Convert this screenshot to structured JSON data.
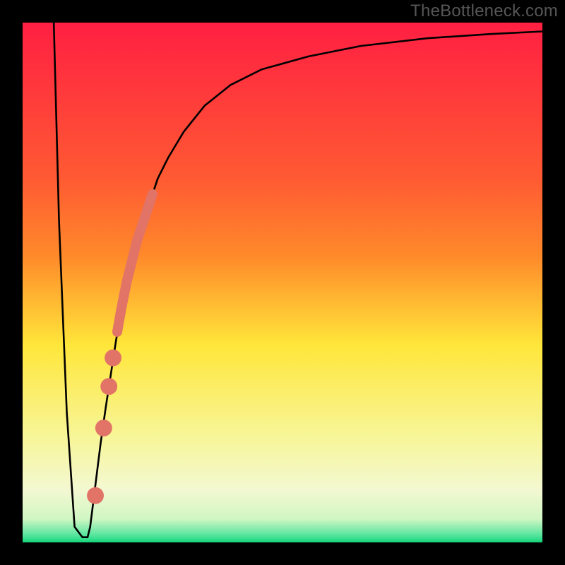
{
  "watermark": "TheBottleneck.com",
  "colors": {
    "frame": "#000000",
    "curve": "#000000",
    "marker": "#e27367",
    "gradient_top": "#ff1f42",
    "gradient_mid_upper": "#ff8a2a",
    "gradient_mid": "#ffe63a",
    "gradient_mid_lower": "#f7f69a",
    "gradient_low": "#d0f6c3",
    "gradient_bottom": "#14d47a"
  },
  "chart_data": {
    "type": "line",
    "title": "",
    "xlabel": "",
    "ylabel": "",
    "xlim": [
      0,
      100
    ],
    "ylim": [
      0,
      100
    ],
    "curve": {
      "x": [
        6,
        7,
        8.5,
        10,
        11.5,
        12.5,
        13,
        14,
        15,
        16,
        18,
        20,
        22,
        24,
        26,
        28,
        31,
        35,
        40,
        46,
        55,
        65,
        78,
        90,
        100
      ],
      "y": [
        100,
        62,
        25,
        3,
        1,
        1,
        3,
        11,
        19,
        26,
        39,
        50,
        58,
        64,
        70,
        74,
        79,
        84,
        88,
        91,
        93.5,
        95.5,
        97,
        97.8,
        98.3
      ]
    },
    "markers": [
      {
        "x": 14.0,
        "y": 9.0,
        "r": 1.2
      },
      {
        "x": 15.6,
        "y": 22.0,
        "r": 1.2
      },
      {
        "x": 16.6,
        "y": 30.0,
        "r": 1.2
      },
      {
        "x": 17.4,
        "y": 35.5,
        "r": 1.2
      }
    ],
    "thick_segment": {
      "x": [
        18.2,
        19.0,
        20.0,
        21.0,
        22.0,
        23.0,
        24.0,
        25.0
      ],
      "y": [
        40.5,
        45.0,
        50.0,
        54.0,
        58.0,
        61.0,
        64.0,
        67.0
      ]
    },
    "legend": [],
    "grid": false
  }
}
